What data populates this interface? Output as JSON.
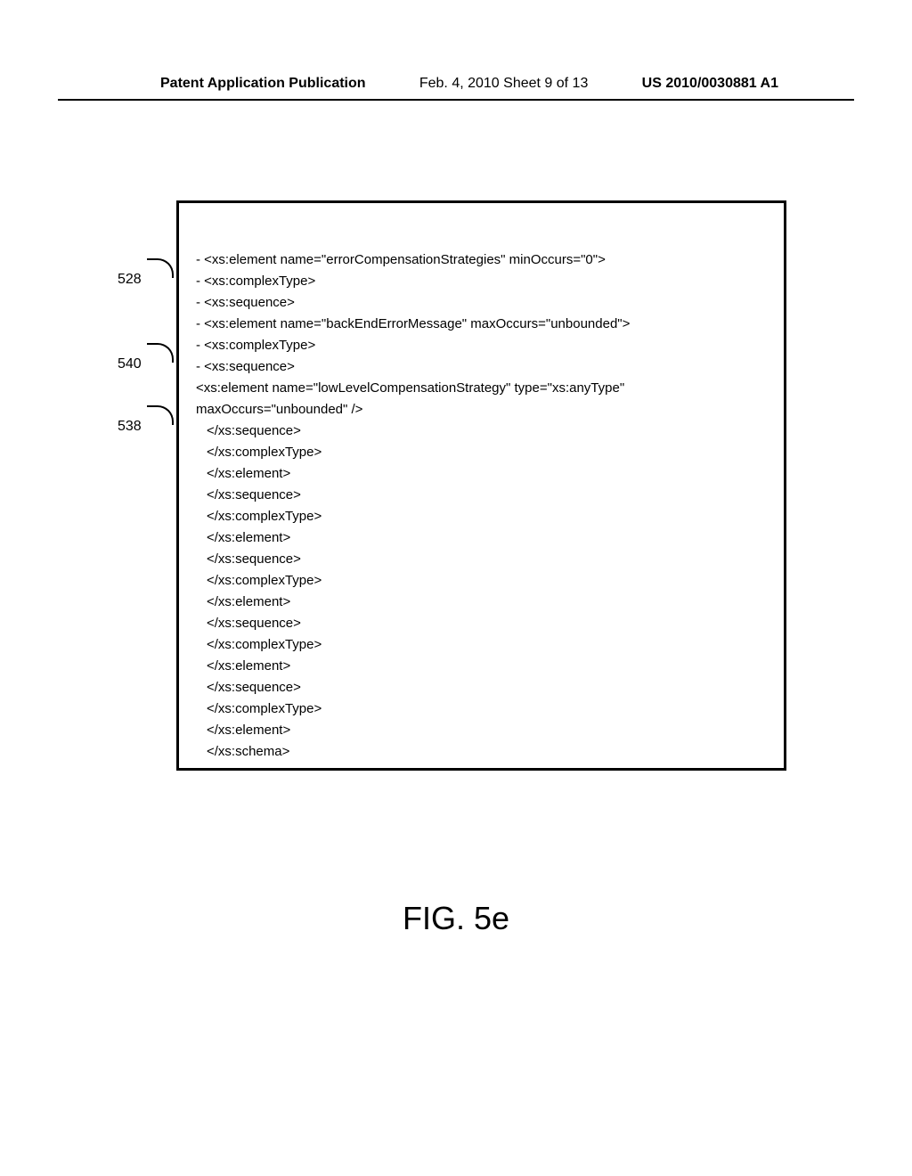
{
  "header": {
    "left": "Patent Application Publication",
    "center": "Feb. 4, 2010  Sheet 9 of 13",
    "right": "US 2010/0030881 A1"
  },
  "callouts": {
    "c528": "528",
    "c540": "540",
    "c538": "538"
  },
  "code": {
    "line1": "- <xs:element name=\"errorCompensationStrategies\" minOccurs=\"0\">",
    "line2": "- <xs:complexType>",
    "line3": "- <xs:sequence>",
    "line4": "- <xs:element name=\"backEndErrorMessage\" maxOccurs=\"unbounded\">",
    "line5": "- <xs:complexType>",
    "line6": "- <xs:sequence>",
    "line7": "  <xs:element name=\"lowLevelCompensationStrategy\" type=\"xs:anyType\"",
    "line8": "maxOccurs=\"unbounded\" />",
    "line9": "</xs:sequence>",
    "line10": "</xs:complexType>",
    "line11": "</xs:element>",
    "line12": "</xs:sequence>",
    "line13": "</xs:complexType>",
    "line14": "</xs:element>",
    "line15": "</xs:sequence>",
    "line16": "</xs:complexType>",
    "line17": "</xs:element>",
    "line18": "</xs:sequence>",
    "line19": "</xs:complexType>",
    "line20": "</xs:element>",
    "line21": "</xs:sequence>",
    "line22": "</xs:complexType>",
    "line23": "</xs:element>",
    "line24": "</xs:schema>"
  },
  "figure_label": "FIG. 5e"
}
